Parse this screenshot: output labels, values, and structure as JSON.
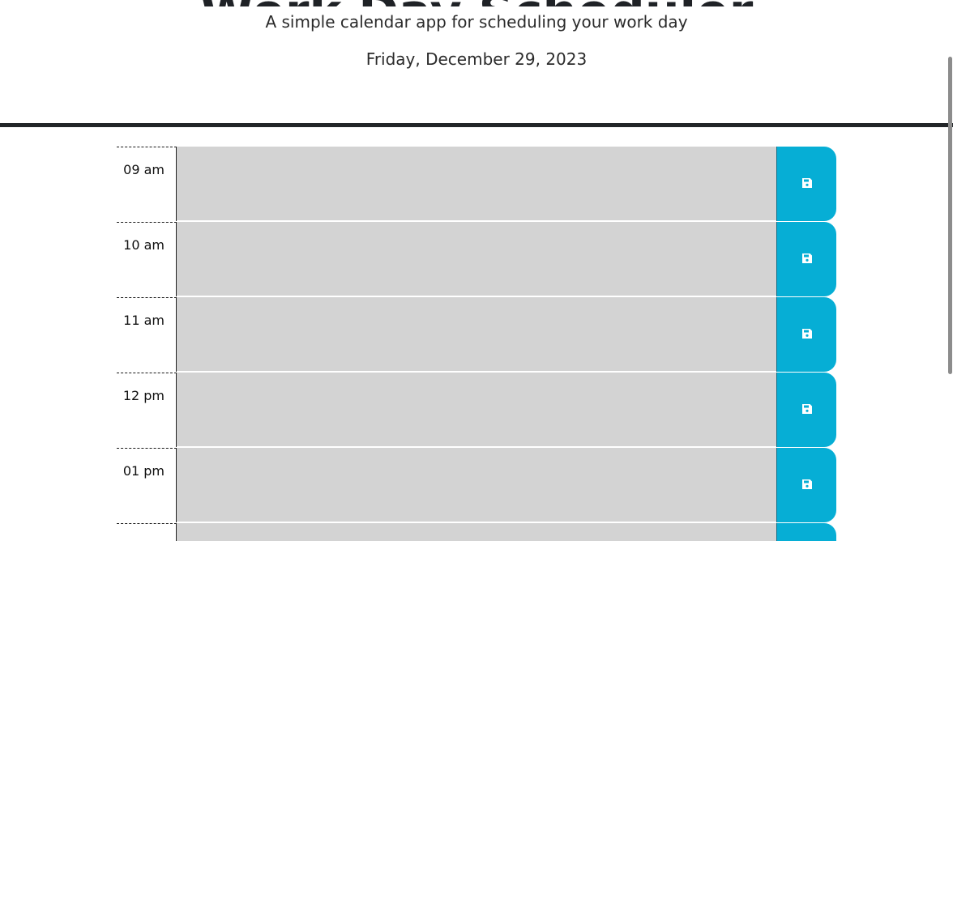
{
  "header": {
    "title": "Work Day Scheduler",
    "subtitle": "A simple calendar app for scheduling your work day",
    "current_day": "Friday, December 29, 2023"
  },
  "colors": {
    "past": "#d3d3d3",
    "save_button": "#06aed5",
    "header_rule": "#222528"
  },
  "time_blocks": [
    {
      "hour": "09 am",
      "description": "",
      "save_icon": "save-icon"
    },
    {
      "hour": "10 am",
      "description": "",
      "save_icon": "save-icon"
    },
    {
      "hour": "11 am",
      "description": "",
      "save_icon": "save-icon"
    },
    {
      "hour": "12 pm",
      "description": "",
      "save_icon": "save-icon"
    },
    {
      "hour": "01 pm",
      "description": "",
      "save_icon": "save-icon"
    },
    {
      "hour": "",
      "description": "",
      "save_icon": "save-icon"
    }
  ]
}
